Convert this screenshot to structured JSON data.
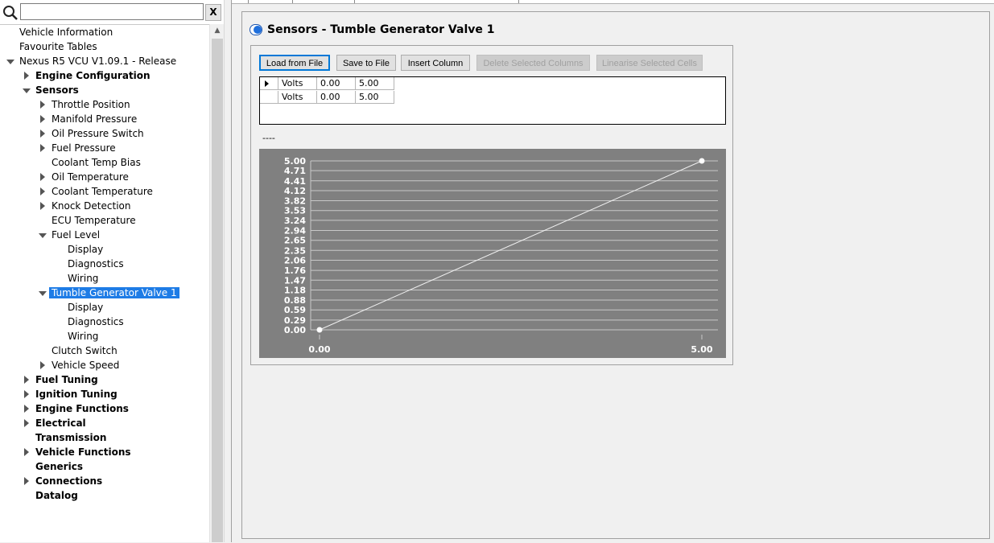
{
  "search": {
    "value": "",
    "placeholder": "",
    "clear_label": "X"
  },
  "tree": [
    {
      "label": "Vehicle Information",
      "level": 0,
      "bold": false,
      "expander": "none"
    },
    {
      "label": "Favourite Tables",
      "level": 0,
      "bold": false,
      "expander": "none"
    },
    {
      "label": "Nexus R5 VCU V1.09.1 - Release",
      "level": 0,
      "bold": false,
      "expander": "down"
    },
    {
      "label": "Engine Configuration",
      "level": 1,
      "bold": true,
      "expander": "right"
    },
    {
      "label": "Sensors",
      "level": 1,
      "bold": true,
      "expander": "down"
    },
    {
      "label": "Throttle Position",
      "level": 2,
      "bold": false,
      "expander": "right"
    },
    {
      "label": "Manifold Pressure",
      "level": 2,
      "bold": false,
      "expander": "right"
    },
    {
      "label": "Oil Pressure Switch",
      "level": 2,
      "bold": false,
      "expander": "right"
    },
    {
      "label": "Fuel Pressure",
      "level": 2,
      "bold": false,
      "expander": "right"
    },
    {
      "label": "Coolant Temp Bias",
      "level": 2,
      "bold": false,
      "expander": "none"
    },
    {
      "label": "Oil Temperature",
      "level": 2,
      "bold": false,
      "expander": "right"
    },
    {
      "label": "Coolant Temperature",
      "level": 2,
      "bold": false,
      "expander": "right"
    },
    {
      "label": "Knock Detection",
      "level": 2,
      "bold": false,
      "expander": "right"
    },
    {
      "label": "ECU Temperature",
      "level": 2,
      "bold": false,
      "expander": "none"
    },
    {
      "label": "Fuel Level",
      "level": 2,
      "bold": false,
      "expander": "down"
    },
    {
      "label": "Display",
      "level": 3,
      "bold": false,
      "expander": "none"
    },
    {
      "label": "Diagnostics",
      "level": 3,
      "bold": false,
      "expander": "none"
    },
    {
      "label": "Wiring",
      "level": 3,
      "bold": false,
      "expander": "none"
    },
    {
      "label": "Tumble Generator Valve 1",
      "level": 2,
      "bold": false,
      "expander": "down",
      "selected": true
    },
    {
      "label": "Display",
      "level": 3,
      "bold": false,
      "expander": "none"
    },
    {
      "label": "Diagnostics",
      "level": 3,
      "bold": false,
      "expander": "none"
    },
    {
      "label": "Wiring",
      "level": 3,
      "bold": false,
      "expander": "none"
    },
    {
      "label": "Clutch Switch",
      "level": 2,
      "bold": false,
      "expander": "none"
    },
    {
      "label": "Vehicle Speed",
      "level": 2,
      "bold": false,
      "expander": "right"
    },
    {
      "label": "Fuel Tuning",
      "level": 1,
      "bold": true,
      "expander": "right"
    },
    {
      "label": "Ignition Tuning",
      "level": 1,
      "bold": true,
      "expander": "right"
    },
    {
      "label": "Engine Functions",
      "level": 1,
      "bold": true,
      "expander": "right"
    },
    {
      "label": "Electrical",
      "level": 1,
      "bold": true,
      "expander": "right"
    },
    {
      "label": "Transmission",
      "level": 1,
      "bold": true,
      "expander": "none"
    },
    {
      "label": "Vehicle Functions",
      "level": 1,
      "bold": true,
      "expander": "right"
    },
    {
      "label": "Generics",
      "level": 1,
      "bold": true,
      "expander": "none"
    },
    {
      "label": "Connections",
      "level": 1,
      "bold": true,
      "expander": "right"
    },
    {
      "label": "Datalog",
      "level": 1,
      "bold": true,
      "expander": "none"
    }
  ],
  "page": {
    "title": "Sensors - Tumble Generator Valve 1"
  },
  "toolbar": {
    "load_label": "Load from File",
    "save_label": "Save to File",
    "insert_label": "Insert Column",
    "delete_label": "Delete Selected Columns",
    "linearise_label": "Linearise Selected Cells"
  },
  "grid": {
    "rows": [
      {
        "label": "Volts",
        "values": [
          "0.00",
          "5.00"
        ]
      },
      {
        "label": "Volts",
        "values": [
          "0.00",
          "5.00"
        ]
      }
    ]
  },
  "dash_text": "----",
  "chart_data": {
    "type": "line",
    "x": [
      0.0,
      5.0
    ],
    "series": [
      {
        "values": [
          0.0,
          5.0
        ]
      }
    ],
    "x_ticks": [
      "0.00",
      "5.00"
    ],
    "y_ticks": [
      "0.00",
      "0.29",
      "0.59",
      "0.88",
      "1.18",
      "1.47",
      "1.76",
      "2.06",
      "2.35",
      "2.65",
      "2.94",
      "3.24",
      "3.53",
      "3.82",
      "4.12",
      "4.41",
      "4.71",
      "5.00"
    ],
    "xlim": [
      0,
      5
    ],
    "ylim": [
      0,
      5
    ],
    "grid": true,
    "colors": {
      "background": "#808080",
      "grid": "#c8c8c8",
      "line": "#f0f0f0",
      "text": "#ffffff"
    }
  }
}
